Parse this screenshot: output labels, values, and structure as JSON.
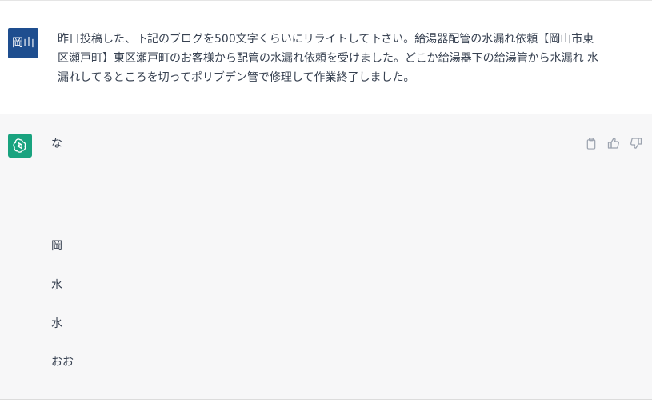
{
  "user": {
    "avatar_text": "岡山",
    "message": "昨日投稿した、下記のブログを500文字くらいにリライトして下さい。給湯器配管の水漏れ依頼【岡山市東区瀬戸町】東区瀬戸町のお客様から配管の水漏れ依頼を受けました。どこか給湯器下の給湯管から水漏れ 水漏れしてるところを切ってポリブデン管で修理して作業終了しました。"
  },
  "assistant": {
    "first_line": "な",
    "lines": [
      "岡",
      "水",
      "水",
      "おお"
    ]
  },
  "colors": {
    "user_avatar_bg": "#1e4e8f",
    "assistant_avatar_bg": "#19a37f",
    "assistant_bg": "#f7f7f8"
  },
  "icons": [
    "openai-logo-icon",
    "clipboard-icon",
    "thumbs-up-icon",
    "thumbs-down-icon"
  ]
}
